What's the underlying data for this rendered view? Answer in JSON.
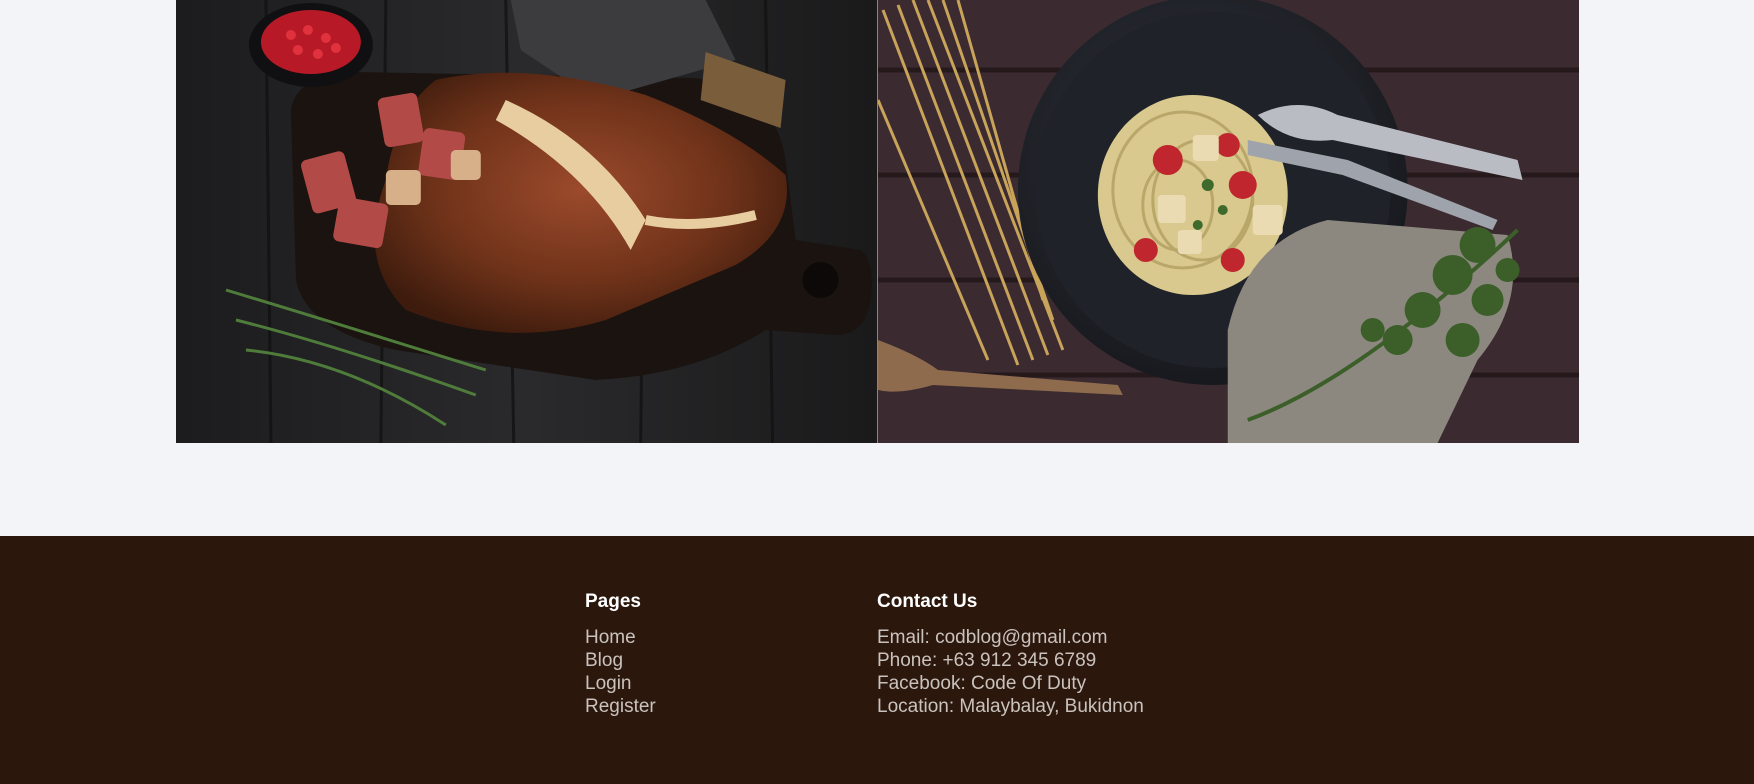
{
  "gallery": {
    "images": [
      {
        "name": "grilled-steak-photo"
      },
      {
        "name": "pasta-dish-photo"
      }
    ]
  },
  "footer": {
    "pages": {
      "heading": "Pages",
      "links": [
        "Home",
        "Blog",
        "Login",
        "Register"
      ]
    },
    "contact": {
      "heading": "Contact Us",
      "items": [
        "Email: codblog@gmail.com",
        "Phone: +63 912 345 6789",
        "Facebook: Code Of Duty",
        "Location: Malaybalay, Bukidnon"
      ]
    }
  },
  "colors": {
    "page_background": "#f3f4f8",
    "footer_background": "#2c170d",
    "footer_heading": "#ffffff",
    "footer_text": "#c9c2bd"
  }
}
